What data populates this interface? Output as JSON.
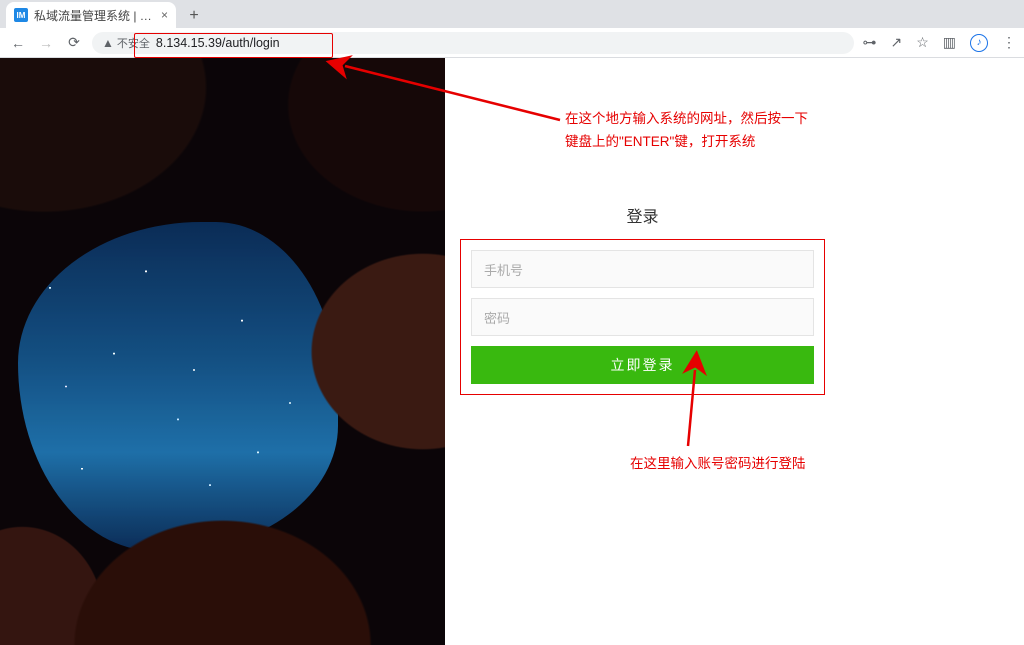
{
  "window": {
    "min_icon": "—",
    "max_icon": "☐",
    "close_icon": "✕"
  },
  "tab": {
    "favicon_text": "IM",
    "title": "私域流量管理系统 | 账号登录?",
    "close": "×",
    "newtab": "+"
  },
  "toolbar": {
    "back": "←",
    "forward": "→",
    "reload": "⟳",
    "insecure_icon": "▲",
    "insecure_label": "不安全",
    "url": "8.134.15.39/auth/login",
    "key_icon": "⊶",
    "share_icon": "↗",
    "star_icon": "☆",
    "puzzle_icon": "▥",
    "ext_icon": "♪",
    "menu_icon": "⋮"
  },
  "login": {
    "title": "登录",
    "phone_placeholder": "手机号",
    "password_placeholder": "密码",
    "submit": "立即登录"
  },
  "annotations": {
    "a1_line1": "在这个地方输入系统的网址，然后按一下",
    "a1_line2": "键盘上的\"ENTER\"键，打开系统",
    "a2": "在这里输入账号密码进行登陆"
  }
}
